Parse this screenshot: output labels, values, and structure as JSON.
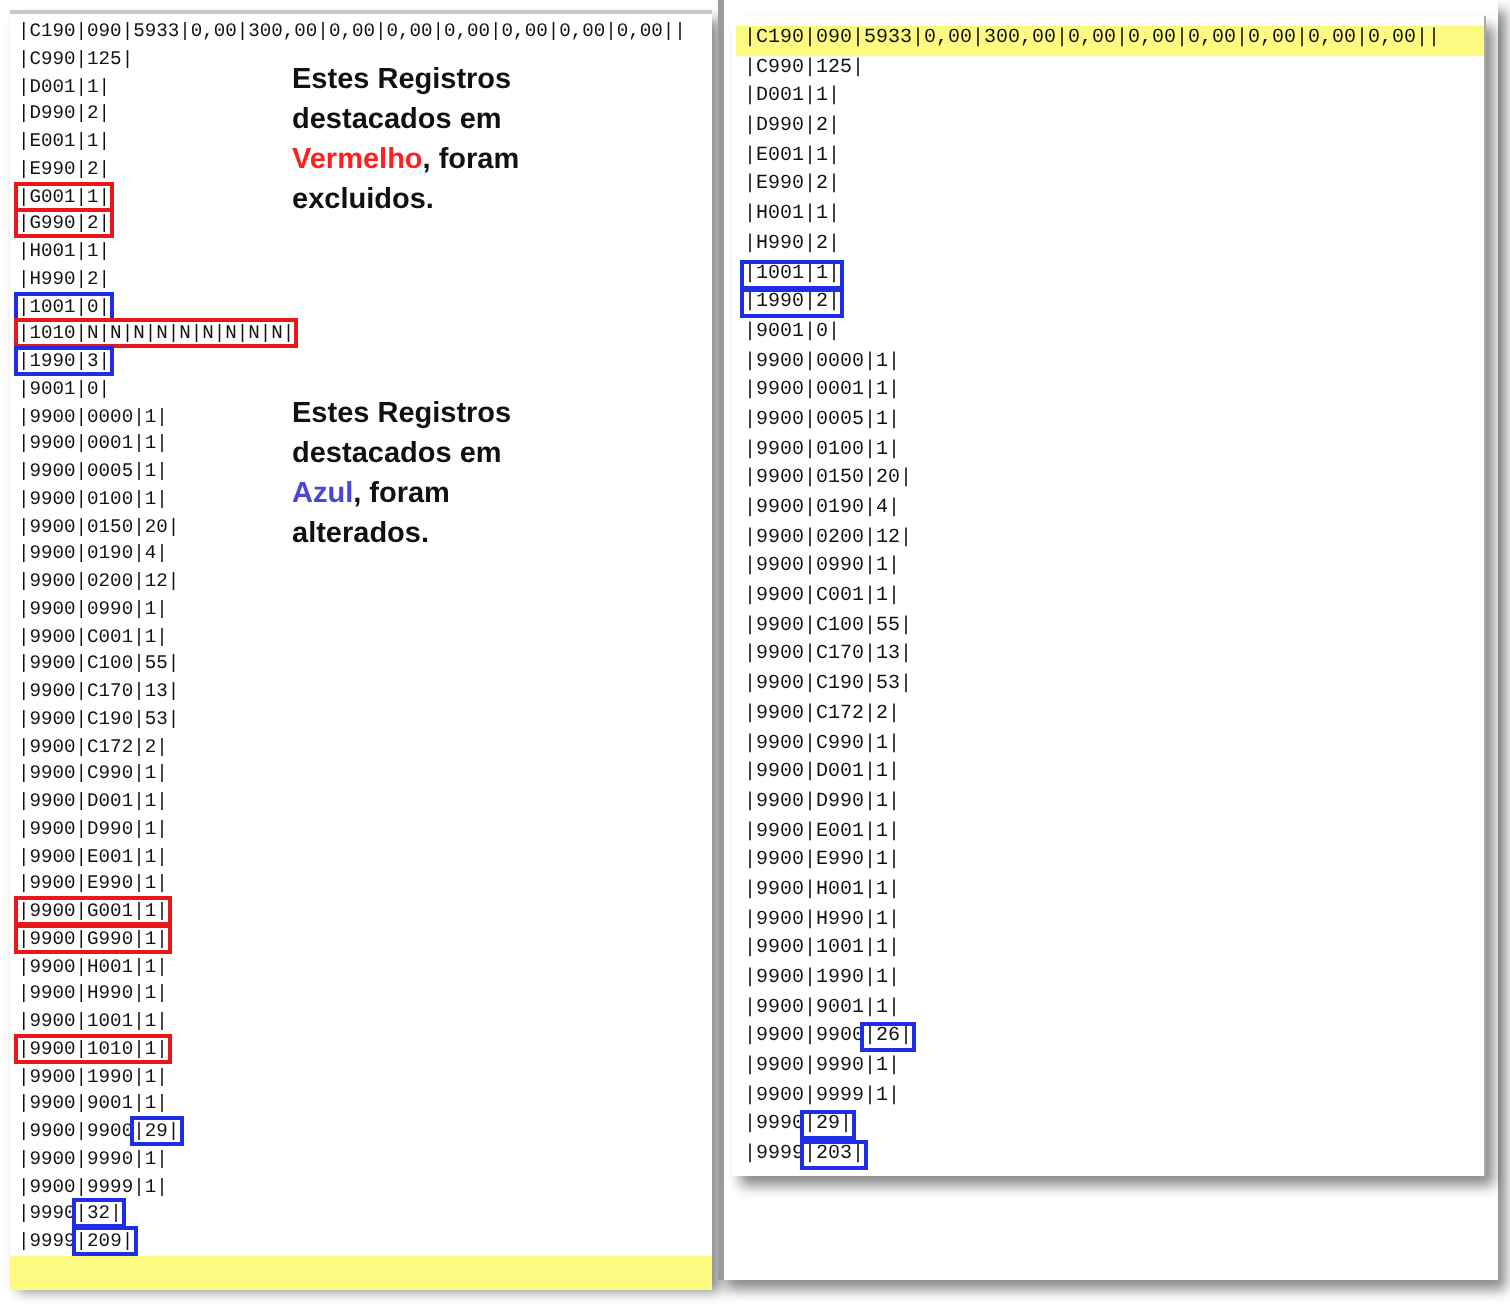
{
  "panes": [
    {
      "lines": [
        {
          "current": false,
          "segments": [
            {
              "text": "|C190|090|5933|0,00|300,00|0,00|0,00|0,00|0,00|0,00|0,00||"
            }
          ]
        },
        {
          "current": false,
          "segments": [
            {
              "text": "|C990|125|"
            }
          ]
        },
        {
          "current": false,
          "segments": [
            {
              "text": "|D001|1|"
            }
          ]
        },
        {
          "current": false,
          "segments": [
            {
              "text": "|D990|2|"
            }
          ]
        },
        {
          "current": false,
          "segments": [
            {
              "text": "|E001|1|"
            }
          ]
        },
        {
          "current": false,
          "segments": [
            {
              "text": "|E990|2|"
            }
          ]
        },
        {
          "current": false,
          "segments": [
            {
              "text": "|G001|1|",
              "color": "#e8171c"
            }
          ]
        },
        {
          "current": false,
          "segments": [
            {
              "text": "|G990|2|",
              "color": "#e8171c"
            }
          ]
        },
        {
          "current": false,
          "segments": [
            {
              "text": "|H001|1|"
            }
          ]
        },
        {
          "current": false,
          "segments": [
            {
              "text": "|H990|2|"
            }
          ]
        },
        {
          "current": false,
          "segments": [
            {
              "text": "|1001|0|",
              "color": "#1e2ee6"
            }
          ]
        },
        {
          "current": false,
          "segments": [
            {
              "text": "|1010|N|N|N|N|N|N|N|N|N|",
              "color": "#e8171c"
            }
          ]
        },
        {
          "current": false,
          "segments": [
            {
              "text": "|1990|3|",
              "color": "#1e2ee6"
            }
          ]
        },
        {
          "current": false,
          "segments": [
            {
              "text": "|9001|0|"
            }
          ]
        },
        {
          "current": false,
          "segments": [
            {
              "text": "|9900|0000|1|"
            }
          ]
        },
        {
          "current": false,
          "segments": [
            {
              "text": "|9900|0001|1|"
            }
          ]
        },
        {
          "current": false,
          "segments": [
            {
              "text": "|9900|0005|1|"
            }
          ]
        },
        {
          "current": false,
          "segments": [
            {
              "text": "|9900|0100|1|"
            }
          ]
        },
        {
          "current": false,
          "segments": [
            {
              "text": "|9900|0150|20|"
            }
          ]
        },
        {
          "current": false,
          "segments": [
            {
              "text": "|9900|0190|4|"
            }
          ]
        },
        {
          "current": false,
          "segments": [
            {
              "text": "|9900|0200|12|"
            }
          ]
        },
        {
          "current": false,
          "segments": [
            {
              "text": "|9900|0990|1|"
            }
          ]
        },
        {
          "current": false,
          "segments": [
            {
              "text": "|9900|C001|1|"
            }
          ]
        },
        {
          "current": false,
          "segments": [
            {
              "text": "|9900|C100|55|"
            }
          ]
        },
        {
          "current": false,
          "segments": [
            {
              "text": "|9900|C170|13|"
            }
          ]
        },
        {
          "current": false,
          "segments": [
            {
              "text": "|9900|C190|53|"
            }
          ]
        },
        {
          "current": false,
          "segments": [
            {
              "text": "|9900|C172|2|"
            }
          ]
        },
        {
          "current": false,
          "segments": [
            {
              "text": "|9900|C990|1|"
            }
          ]
        },
        {
          "current": false,
          "segments": [
            {
              "text": "|9900|D001|1|"
            }
          ]
        },
        {
          "current": false,
          "segments": [
            {
              "text": "|9900|D990|1|"
            }
          ]
        },
        {
          "current": false,
          "segments": [
            {
              "text": "|9900|E001|1|"
            }
          ]
        },
        {
          "current": false,
          "segments": [
            {
              "text": "|9900|E990|1|"
            }
          ]
        },
        {
          "current": false,
          "segments": [
            {
              "text": "|9900|G001|1|",
              "color": "#e8171c"
            }
          ]
        },
        {
          "current": false,
          "segments": [
            {
              "text": "|9900|G990|1|",
              "color": "#e8171c"
            }
          ]
        },
        {
          "current": false,
          "segments": [
            {
              "text": "|9900|H001|1|"
            }
          ]
        },
        {
          "current": false,
          "segments": [
            {
              "text": "|9900|H990|1|"
            }
          ]
        },
        {
          "current": false,
          "segments": [
            {
              "text": "|9900|1001|1|"
            }
          ]
        },
        {
          "current": false,
          "segments": [
            {
              "text": "|9900|1010|1|",
              "color": "#e8171c"
            }
          ]
        },
        {
          "current": false,
          "segments": [
            {
              "text": "|9900|1990|1|"
            }
          ]
        },
        {
          "current": false,
          "segments": [
            {
              "text": "|9900|9001|1|"
            }
          ]
        },
        {
          "current": false,
          "segments": [
            {
              "text": "|9900|9900"
            },
            {
              "text": "|29|",
              "color": "#1e2ee6"
            }
          ]
        },
        {
          "current": false,
          "segments": [
            {
              "text": "|9900|9990|1|"
            }
          ]
        },
        {
          "current": false,
          "segments": [
            {
              "text": "|9900|9999|1|"
            }
          ]
        },
        {
          "current": false,
          "segments": [
            {
              "text": "|9990"
            },
            {
              "text": "|32|",
              "color": "#1e2ee6"
            }
          ]
        },
        {
          "current": false,
          "segments": [
            {
              "text": "|9999"
            },
            {
              "text": "|209|",
              "color": "#1e2ee6"
            }
          ]
        },
        {
          "current": true
        }
      ],
      "notes": [
        {
          "parts": [
            {
              "text": "Estes Registros destacados em "
            },
            {
              "text": "Vermelho",
              "color": "#ff1f1f"
            },
            {
              "text": ", foram excluidos."
            }
          ]
        },
        {
          "parts": [
            {
              "text": "Estes Registros destacados em "
            },
            {
              "text": "Azul",
              "color": "#4b45d8"
            },
            {
              "text": ", foram alterados."
            }
          ]
        }
      ]
    },
    {
      "lines": [
        {
          "current": true,
          "segments": [
            {
              "text": "|C190|090|5933|0,00|300,00|0,00|0,00|0,00|0,00|0,00|0,00||"
            }
          ]
        },
        {
          "current": false,
          "segments": [
            {
              "text": "|C990|125|"
            }
          ]
        },
        {
          "current": false,
          "segments": [
            {
              "text": "|D001|1|"
            }
          ]
        },
        {
          "current": false,
          "segments": [
            {
              "text": "|D990|2|"
            }
          ]
        },
        {
          "current": false,
          "segments": [
            {
              "text": "|E001|1|"
            }
          ]
        },
        {
          "current": false,
          "segments": [
            {
              "text": "|E990|2|"
            }
          ]
        },
        {
          "current": false,
          "segments": [
            {
              "text": "|H001|1|"
            }
          ]
        },
        {
          "current": false,
          "segments": [
            {
              "text": "|H990|2|"
            }
          ]
        },
        {
          "current": false,
          "segments": [
            {
              "text": "|1001|1|",
              "color": "#1e2ee6"
            }
          ]
        },
        {
          "current": false,
          "segments": [
            {
              "text": "|1990|2|",
              "color": "#1e2ee6"
            }
          ]
        },
        {
          "current": false,
          "segments": [
            {
              "text": "|9001|0|"
            }
          ]
        },
        {
          "current": false,
          "segments": [
            {
              "text": "|9900|0000|1|"
            }
          ]
        },
        {
          "current": false,
          "segments": [
            {
              "text": "|9900|0001|1|"
            }
          ]
        },
        {
          "current": false,
          "segments": [
            {
              "text": "|9900|0005|1|"
            }
          ]
        },
        {
          "current": false,
          "segments": [
            {
              "text": "|9900|0100|1|"
            }
          ]
        },
        {
          "current": false,
          "segments": [
            {
              "text": "|9900|0150|20|"
            }
          ]
        },
        {
          "current": false,
          "segments": [
            {
              "text": "|9900|0190|4|"
            }
          ]
        },
        {
          "current": false,
          "segments": [
            {
              "text": "|9900|0200|12|"
            }
          ]
        },
        {
          "current": false,
          "segments": [
            {
              "text": "|9900|0990|1|"
            }
          ]
        },
        {
          "current": false,
          "segments": [
            {
              "text": "|9900|C001|1|"
            }
          ]
        },
        {
          "current": false,
          "segments": [
            {
              "text": "|9900|C100|55|"
            }
          ]
        },
        {
          "current": false,
          "segments": [
            {
              "text": "|9900|C170|13|"
            }
          ]
        },
        {
          "current": false,
          "segments": [
            {
              "text": "|9900|C190|53|"
            }
          ]
        },
        {
          "current": false,
          "segments": [
            {
              "text": "|9900|C172|2|"
            }
          ]
        },
        {
          "current": false,
          "segments": [
            {
              "text": "|9900|C990|1|"
            }
          ]
        },
        {
          "current": false,
          "segments": [
            {
              "text": "|9900|D001|1|"
            }
          ]
        },
        {
          "current": false,
          "segments": [
            {
              "text": "|9900|D990|1|"
            }
          ]
        },
        {
          "current": false,
          "segments": [
            {
              "text": "|9900|E001|1|"
            }
          ]
        },
        {
          "current": false,
          "segments": [
            {
              "text": "|9900|E990|1|"
            }
          ]
        },
        {
          "current": false,
          "segments": [
            {
              "text": "|9900|H001|1|"
            }
          ]
        },
        {
          "current": false,
          "segments": [
            {
              "text": "|9900|H990|1|"
            }
          ]
        },
        {
          "current": false,
          "segments": [
            {
              "text": "|9900|1001|1|"
            }
          ]
        },
        {
          "current": false,
          "segments": [
            {
              "text": "|9900|1990|1|"
            }
          ]
        },
        {
          "current": false,
          "segments": [
            {
              "text": "|9900|9001|1|"
            }
          ]
        },
        {
          "current": false,
          "segments": [
            {
              "text": "|9900|9900"
            },
            {
              "text": "|26|",
              "color": "#1e2ee6"
            }
          ]
        },
        {
          "current": false,
          "segments": [
            {
              "text": "|9900|9990|1|"
            }
          ]
        },
        {
          "current": false,
          "segments": [
            {
              "text": "|9900|9999|1|"
            }
          ]
        },
        {
          "current": false,
          "segments": [
            {
              "text": "|9990"
            },
            {
              "text": "|29|",
              "color": "#1e2ee6"
            }
          ]
        },
        {
          "current": false,
          "segments": [
            {
              "text": "|9999"
            },
            {
              "text": "|203|",
              "color": "#1e2ee6"
            }
          ]
        }
      ]
    }
  ]
}
